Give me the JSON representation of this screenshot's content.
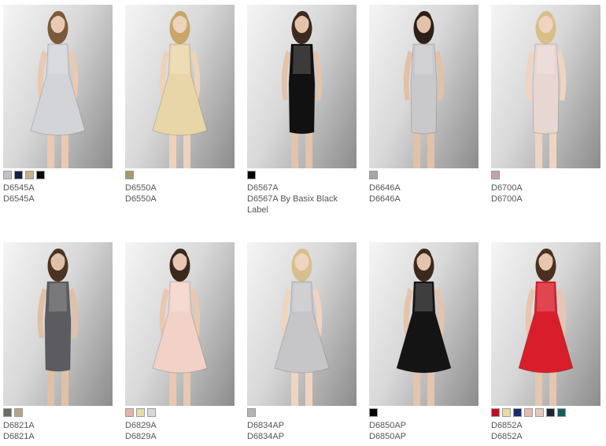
{
  "products": [
    {
      "sku": "D6545A",
      "name": "D6545A",
      "colors": [
        "#c0c4c8",
        "#1a2040",
        "#c9b089",
        "#0a0a0a"
      ],
      "dress_color": "#d2d4d8",
      "dress_style": "flare",
      "hair": "#7a5a3a",
      "skin": "#e9c9b1"
    },
    {
      "sku": "D6550A",
      "name": "D6550A",
      "colors": [
        "#a8996a"
      ],
      "dress_color": "#e8d6a8",
      "dress_style": "flare",
      "hair": "#c9a76a",
      "skin": "#edd2bc"
    },
    {
      "sku": "D6567A",
      "name": "D6567A By Basix Black Label",
      "colors": [
        "#000000"
      ],
      "dress_color": "#111111",
      "dress_style": "sheath",
      "hair": "#3c2a1e",
      "skin": "#e3c3aa"
    },
    {
      "sku": "D6646A",
      "name": "D6646A",
      "colors": [
        "#a6a6aa"
      ],
      "dress_color": "#c9c9cc",
      "dress_style": "sheath",
      "hair": "#2e2018",
      "skin": "#e2c1a8"
    },
    {
      "sku": "D6700A",
      "name": "D6700A",
      "colors": [
        "#c4a4a8"
      ],
      "dress_color": "#e8d6d2",
      "dress_style": "sheath",
      "hair": "#d8bf8a",
      "skin": "#efd4c2"
    },
    {
      "sku": "D6821A",
      "name": "D6821A",
      "colors": [
        "#6e6a66",
        "#b8a28c"
      ],
      "dress_color": "#5c5c60",
      "dress_style": "sheath",
      "hair": "#4a3424",
      "skin": "#e0c0a6"
    },
    {
      "sku": "D6829A",
      "name": "D6829A",
      "colors": [
        "#e4b4a8",
        "#e8dca8",
        "#d8d8d8"
      ],
      "dress_color": "#f2d2c6",
      "dress_style": "flare",
      "hair": "#3a2a1e",
      "skin": "#e8c8b0"
    },
    {
      "sku": "D6834AP",
      "name": "D6834AP",
      "colors": [
        "#b4b4b8"
      ],
      "dress_color": "#c6c6c8",
      "dress_style": "flare",
      "hair": "#d6c08e",
      "skin": "#efd4c0"
    },
    {
      "sku": "D6850AP",
      "name": "D6850AP",
      "colors": [
        "#000000"
      ],
      "dress_color": "#141414",
      "dress_style": "flare",
      "hair": "#3a2a1e",
      "skin": "#e4c4ac"
    },
    {
      "sku": "D6852A",
      "name": "D6852A",
      "colors": [
        "#b8102a",
        "#e8dca0",
        "#1a2a6a",
        "#e8b8b0",
        "#e4c8c0",
        "#1e2430",
        "#1a5a5a"
      ],
      "dress_color": "#d81e2a",
      "dress_style": "flare",
      "hair": "#4a3020",
      "skin": "#e6c6ae"
    }
  ]
}
